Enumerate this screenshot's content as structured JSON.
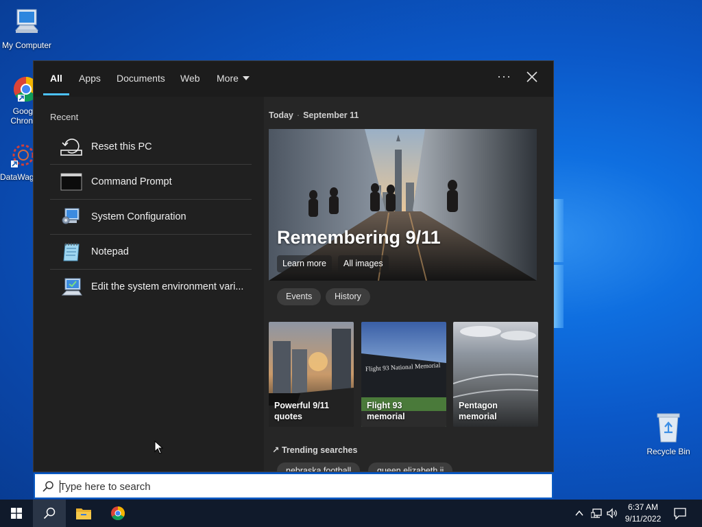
{
  "desktop": {
    "icons": [
      {
        "label": "My Computer"
      },
      {
        "label": "Goog Chron"
      },
      {
        "label": "DataWag"
      },
      {
        "label": "Recycle Bin"
      }
    ]
  },
  "search_panel": {
    "tabs": [
      {
        "label": "All",
        "active": true
      },
      {
        "label": "Apps"
      },
      {
        "label": "Documents"
      },
      {
        "label": "Web"
      },
      {
        "label": "More"
      }
    ],
    "more_icon": "ellipsis-icon",
    "close_icon": "close-icon",
    "recent": {
      "title": "Recent",
      "items": [
        {
          "label": "Reset this PC",
          "icon": "reset-pc-icon"
        },
        {
          "label": "Command Prompt",
          "icon": "command-prompt-icon"
        },
        {
          "label": "System Configuration",
          "icon": "system-configuration-icon"
        },
        {
          "label": "Notepad",
          "icon": "notepad-icon"
        },
        {
          "label": "Edit the system environment vari...",
          "icon": "system-properties-icon"
        }
      ]
    },
    "highlights": {
      "day": "Today",
      "date": "September 11",
      "hero_title": "Remembering 9/11",
      "hero_buttons": [
        "Learn more",
        "All images"
      ],
      "chips": [
        "Events",
        "History"
      ],
      "cards": [
        {
          "caption_line1": "Powerful 9/11",
          "caption_line2": "quotes"
        },
        {
          "caption_line1": "Flight 93",
          "caption_line2": "memorial",
          "sign_text": "Flight 93 National Memorial"
        },
        {
          "caption_line1": "Pentagon",
          "caption_line2": "memorial"
        }
      ],
      "trending_title": "Trending searches",
      "trending": [
        "nebraska football",
        "queen elizabeth ii"
      ]
    }
  },
  "search_box": {
    "placeholder": "Type here to search"
  },
  "taskbar": {
    "time": "6:37 AM",
    "date": "9/11/2022",
    "accent": "#0a5ac2"
  }
}
